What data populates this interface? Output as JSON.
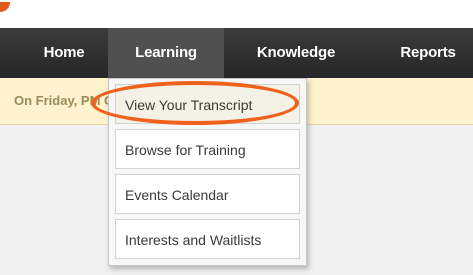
{
  "nav": {
    "items": [
      {
        "label": "Home"
      },
      {
        "label": "Learning"
      },
      {
        "label": "Knowledge"
      },
      {
        "label": "Reports"
      }
    ]
  },
  "notice": {
    "text": "On Friday,                                   PM CST to Saturday, J"
  },
  "learning_menu": {
    "items": [
      {
        "label": "View Your Transcript"
      },
      {
        "label": "Browse for Training"
      },
      {
        "label": "Events Calendar"
      },
      {
        "label": "Interests and Waitlists"
      }
    ]
  },
  "colors": {
    "nav_bg": "#2f2f2f",
    "nav_active_bg": "#505050",
    "notice_bg": "#fff3cf",
    "highlight": "#f0621c"
  }
}
